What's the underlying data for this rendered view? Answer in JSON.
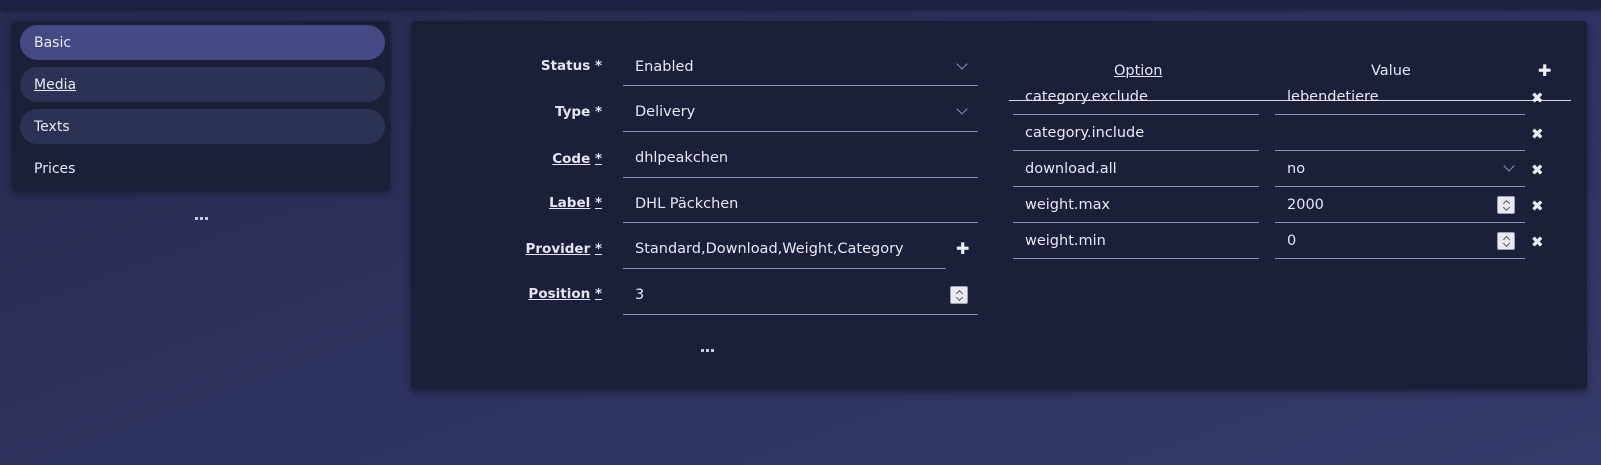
{
  "sidebar": {
    "items": [
      {
        "label": "Basic"
      },
      {
        "label": "Media"
      },
      {
        "label": "Texts"
      },
      {
        "label": "Prices"
      }
    ]
  },
  "form": {
    "status": {
      "label": "Status",
      "required": "*",
      "value": "Enabled"
    },
    "type": {
      "label": "Type",
      "required": "*",
      "value": "Delivery"
    },
    "code": {
      "label": "Code",
      "required": "*",
      "value": "dhlpeakchen"
    },
    "label": {
      "label": "Label",
      "required": "*",
      "value": "DHL Päckchen"
    },
    "provider": {
      "label": "Provider",
      "required": "*",
      "value": "Standard,Download,Weight,Category"
    },
    "position": {
      "label": "Position",
      "required": "*",
      "value": "3"
    }
  },
  "options": {
    "headers": {
      "option": "Option",
      "value": "Value"
    },
    "rows": [
      {
        "option": "category.exclude",
        "value": "lebendetiere"
      },
      {
        "option": "category.include",
        "value": ""
      },
      {
        "option": "download.all",
        "value": "no"
      },
      {
        "option": "weight.max",
        "value": "2000"
      },
      {
        "option": "weight.min",
        "value": "0"
      }
    ]
  },
  "icons": {
    "add": "plus-icon",
    "remove": "close-icon",
    "more": "more-dots-icon"
  }
}
